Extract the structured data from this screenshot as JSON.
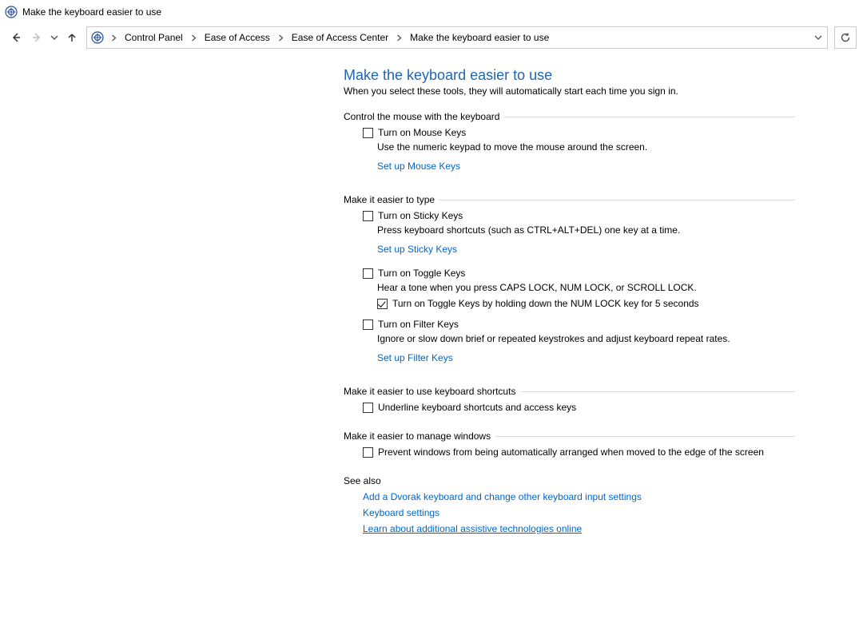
{
  "window": {
    "title": "Make the keyboard easier to use"
  },
  "breadcrumb": {
    "items": [
      {
        "label": "Control Panel"
      },
      {
        "label": "Ease of Access"
      },
      {
        "label": "Ease of Access Center"
      },
      {
        "label": "Make the keyboard easier to use"
      }
    ]
  },
  "page": {
    "title": "Make the keyboard easier to use",
    "subtitle": "When you select these tools, they will automatically start each time you sign in."
  },
  "groups": {
    "mouse": {
      "heading": "Control the mouse with the keyboard",
      "mousekeys": {
        "label": "Turn on Mouse Keys",
        "desc": "Use the numeric keypad to move the mouse around the screen.",
        "link": "Set up Mouse Keys"
      }
    },
    "type": {
      "heading": "Make it easier to type",
      "sticky": {
        "label": "Turn on Sticky Keys",
        "desc": "Press keyboard shortcuts (such as CTRL+ALT+DEL) one key at a time.",
        "link": "Set up Sticky Keys"
      },
      "toggle": {
        "label": "Turn on Toggle Keys",
        "desc": "Hear a tone when you press CAPS LOCK, NUM LOCK, or SCROLL LOCK.",
        "hold": "Turn on Toggle Keys by holding down the NUM LOCK key for 5 seconds"
      },
      "filter": {
        "label": "Turn on Filter Keys",
        "desc": "Ignore or slow down brief or repeated keystrokes and adjust keyboard repeat rates.",
        "link": "Set up Filter Keys"
      }
    },
    "shortcuts": {
      "heading": "Make it easier to use keyboard shortcuts",
      "underline": {
        "label": "Underline keyboard shortcuts and access keys"
      }
    },
    "windows": {
      "heading": "Make it easier to manage windows",
      "prevent": {
        "label": "Prevent windows from being automatically arranged when moved to the edge of the screen"
      }
    }
  },
  "seealso": {
    "heading": "See also",
    "links": {
      "dvorak": "Add a Dvorak keyboard and change other keyboard input settings",
      "kbsettings": "Keyboard settings",
      "learn": "Learn about additional assistive technologies online"
    }
  }
}
